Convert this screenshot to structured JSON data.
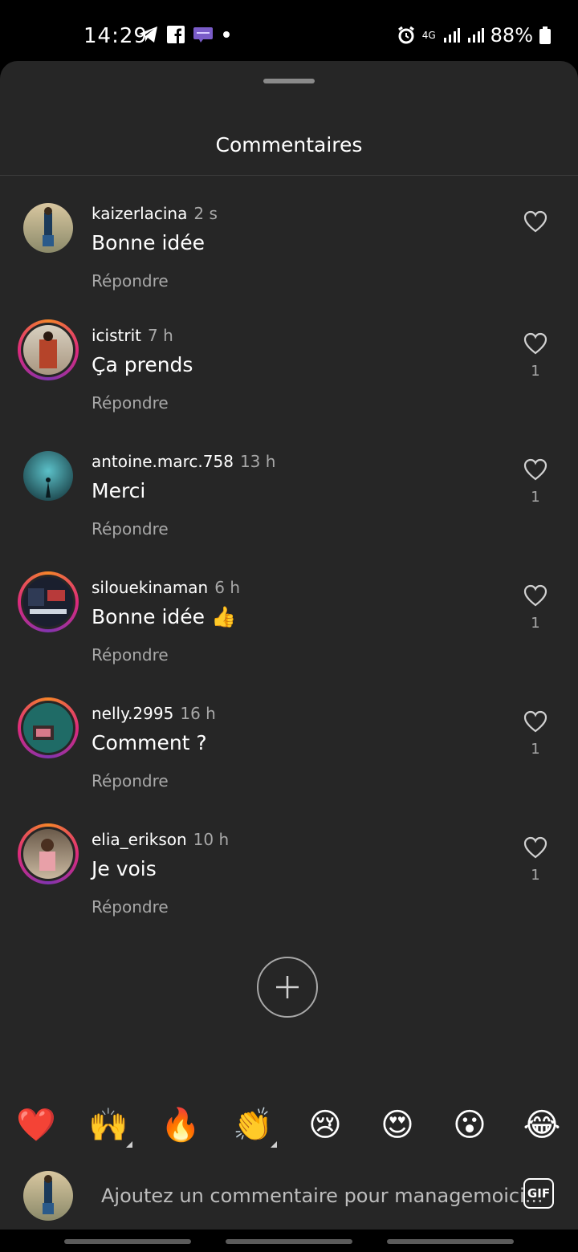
{
  "status_bar": {
    "time": "14:29",
    "battery": "88%",
    "network": "4G",
    "icons": [
      "telegram-icon",
      "facebook-icon",
      "messenger-icon",
      "dot-icon",
      "alarm-icon",
      "signal-icon",
      "battery-icon"
    ]
  },
  "sheet": {
    "title": "Commentaires"
  },
  "comments": [
    {
      "username": "kaizerlacina",
      "time": "2 s",
      "text": "Bonne idée",
      "reply_label": "Répondre",
      "likes": "",
      "story_ring": false
    },
    {
      "username": "icistrit",
      "time": "7 h",
      "text": "Ça prends",
      "reply_label": "Répondre",
      "likes": "1",
      "story_ring": true
    },
    {
      "username": "antoine.marc.758",
      "time": "13 h",
      "text": "Merci",
      "reply_label": "Répondre",
      "likes": "1",
      "story_ring": false
    },
    {
      "username": "silouekinaman",
      "time": "6 h",
      "text": "Bonne idée 👍",
      "reply_label": "Répondre",
      "likes": "1",
      "story_ring": true
    },
    {
      "username": "nelly.2995",
      "time": "16 h",
      "text": "Comment ?",
      "reply_label": "Répondre",
      "likes": "1",
      "story_ring": true
    },
    {
      "username": "elia_erikson",
      "time": "10 h",
      "text": "Je vois",
      "reply_label": "Répondre",
      "likes": "1",
      "story_ring": true
    }
  ],
  "emoji_bar": [
    "❤️",
    "🙌",
    "🔥",
    "👏",
    "😢",
    "😍",
    "😮",
    "😂"
  ],
  "composer": {
    "placeholder": "Ajoutez un commentaire pour managemoici...",
    "gif_label": "GIF"
  },
  "colors": {
    "background": "#262626",
    "muted_text": "#a8a8a8",
    "ring_start": "#f58529",
    "ring_end": "#dd2a7b"
  }
}
